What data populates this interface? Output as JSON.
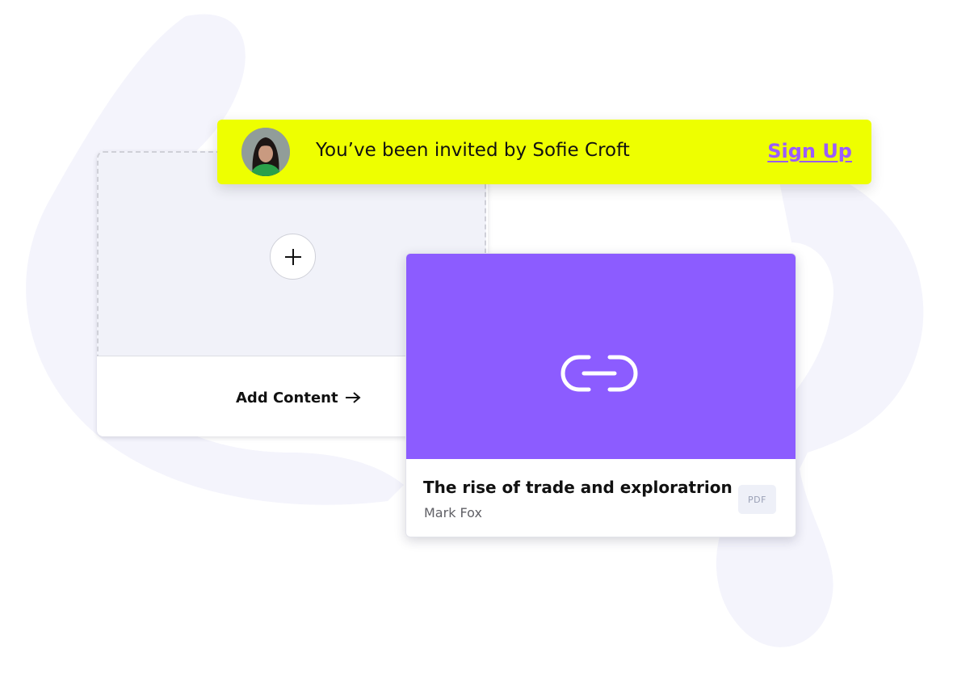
{
  "invite": {
    "message": "You’ve been invited by Sofie Croft",
    "signup_label": "Sign Up"
  },
  "add_content": {
    "label": "Add Content",
    "plus_icon": "plus-icon",
    "arrow_icon": "arrow-right-icon"
  },
  "resource": {
    "title": "The rise of trade and exploratrion",
    "author": "Mark Fox",
    "type_badge": "PDF",
    "thumbnail_icon": "link-icon"
  },
  "colors": {
    "banner": "#eeff00",
    "accent": "#9a5cff",
    "thumbnail": "#8c5cff",
    "background_shape": "#f4f4fc"
  }
}
